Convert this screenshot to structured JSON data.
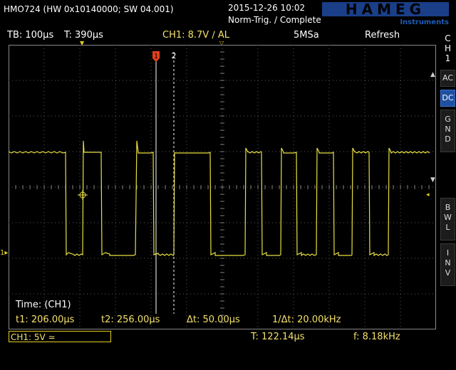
{
  "device": {
    "model_line": "HMO724 (HW 0x10140000; SW 04.001)",
    "datetime": "2015-12-26 10:02",
    "trigger_status": "Norm-Trig. / Complete",
    "brand": "HAMEG",
    "brand_sub": "Instruments"
  },
  "status": {
    "timebase": "TB: 100µs",
    "trigger_time": "T: 390µs",
    "ch1_trigger": "CH1: 8.7V ∕ AL",
    "sample_rate": "5MSa",
    "acq_mode": "Refresh"
  },
  "side_panel": {
    "channel": "C\nH\n1",
    "buttons": [
      {
        "label": "AC",
        "active": false
      },
      {
        "label": "DC",
        "active": true
      },
      {
        "label": "G\nN\nD",
        "active": false
      },
      {
        "label": "B\nW\nL",
        "active": false
      },
      {
        "label": "I\nN\nV",
        "active": false
      }
    ]
  },
  "cursors": {
    "title": "Time: (CH1)",
    "t1": "t1: 206.00µs",
    "t2": "t2: 256.00µs",
    "dt": "Δt: 50.00µs",
    "inv_dt": "1/Δt: 20.00kHz",
    "marker1": "1",
    "marker2": "2"
  },
  "bottom": {
    "ch1_scale": "CH1: 5V ≃",
    "period": "T: 122.14µs",
    "frequency": "f: 8.18kHz"
  },
  "markers": {
    "ch1_ground": "1"
  },
  "colors": {
    "trace": "#e8e040",
    "accent": "#e6cf25",
    "cursor_marker": "#e8401c",
    "active_button": "#1e4fa0",
    "grid": "#5a5a5a"
  }
}
